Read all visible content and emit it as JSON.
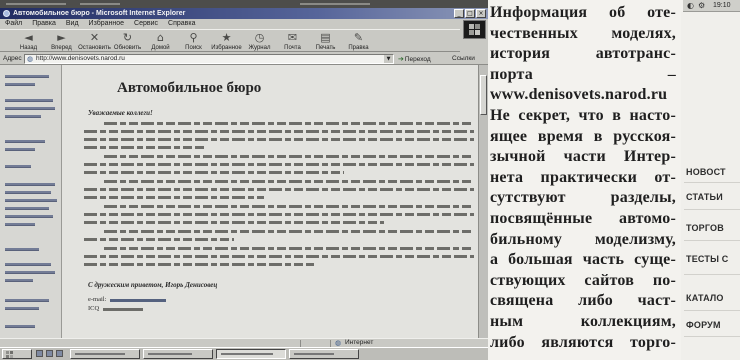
{
  "window": {
    "title": "Автомобильное бюро - Microsoft Internet Explorer"
  },
  "menu": [
    "Файл",
    "Правка",
    "Вид",
    "Избранное",
    "Сервис",
    "Справка"
  ],
  "toolbar": [
    {
      "label": "Назад",
      "icon": "back-arrow-icon"
    },
    {
      "label": "Вперед",
      "icon": "forward-arrow-icon"
    },
    {
      "label": "Остановить",
      "icon": "stop-icon"
    },
    {
      "label": "Обновить",
      "icon": "refresh-icon"
    },
    {
      "label": "Домой",
      "icon": "home-icon"
    },
    {
      "label": "Поиск",
      "icon": "search-icon"
    },
    {
      "label": "Избранное",
      "icon": "favorites-star-icon"
    },
    {
      "label": "Журнал",
      "icon": "history-icon"
    },
    {
      "label": "Почта",
      "icon": "mail-icon"
    },
    {
      "label": "Печать",
      "icon": "print-icon"
    },
    {
      "label": "Правка",
      "icon": "edit-icon"
    }
  ],
  "address": {
    "label": "Адрес",
    "url": "http://www.denisovets.narod.ru",
    "go": "Переход",
    "links": "Ссылки"
  },
  "page": {
    "heading": "Автомобильное бюро",
    "greeting": "Уважаемые коллеги!",
    "signature": "С дружеским приветом, Игорь Денисовец",
    "email_label": "e-mail:",
    "icq_label": "ICQ"
  },
  "status": {
    "zone_label": "Интернет"
  },
  "tray": {
    "clock": "19:10"
  },
  "article": {
    "lines": [
      "Информация об оте-",
      "чественных моделях,",
      "история автотранс-",
      "порта –",
      "www.denisovets.narod.ru",
      "Не секрет, что в насто-",
      "ящее время в русскоя-",
      "зычной части Интер-",
      "нета практически от-",
      "сутствуют разделы,",
      "посвящённые автомо-",
      "бильному моделизму,",
      "а большая часть суще-",
      "ствующих сайтов по-",
      "священа либо част-",
      "ным коллекциям,",
      "либо являются торго-"
    ]
  },
  "sidebar": {
    "items": [
      "НОВОСТ",
      "СТАТЬИ",
      "ТОРГОВ",
      "ТЕСТЫ С",
      "КАТАЛО",
      "ФОРУМ"
    ]
  },
  "colors": {
    "title_bar": "#212c62",
    "page_background": "#e3e3df",
    "article_text": "#1f1f1f"
  }
}
